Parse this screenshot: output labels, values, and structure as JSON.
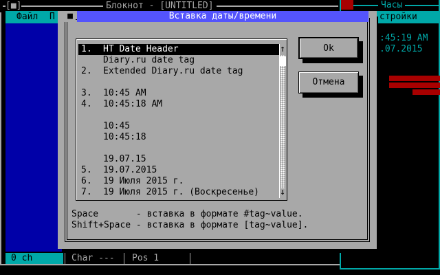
{
  "notepad": {
    "title": "Блокнот - [UNTITLED]",
    "close_glyph": "[■]",
    "menu": [
      "Файл",
      "П"
    ],
    "status": {
      "lines": "0 ch",
      "char": "Char ---",
      "pos": "Pos 1"
    }
  },
  "clock": {
    "title": "Часы",
    "menu_label": "стройки",
    "time": ":45:19 AM",
    "date": ".07.2015"
  },
  "dialog": {
    "title": "Вставка даты/времени",
    "sysmenu_glyph": "■",
    "items": [
      {
        "num": "1.",
        "text": "HT Date Header",
        "selected": true
      },
      {
        "num": "",
        "text": "Diary.ru date tag",
        "selected": false
      },
      {
        "num": "2.",
        "text": "Extended Diary.ru date tag",
        "selected": false
      },
      {
        "num": "",
        "text": "",
        "selected": false
      },
      {
        "num": "3.",
        "text": "10:45 AM",
        "selected": false
      },
      {
        "num": "4.",
        "text": "10:45:18 AM",
        "selected": false
      },
      {
        "num": "",
        "text": "",
        "selected": false
      },
      {
        "num": "",
        "text": "10:45",
        "selected": false
      },
      {
        "num": "",
        "text": "10:45:18",
        "selected": false
      },
      {
        "num": "",
        "text": "",
        "selected": false
      },
      {
        "num": "",
        "text": "19.07.15",
        "selected": false
      },
      {
        "num": "5.",
        "text": "19.07.2015",
        "selected": false
      },
      {
        "num": "6.",
        "text": "19 Июля 2015 г.",
        "selected": false
      },
      {
        "num": "7.",
        "text": "19 Июля 2015 г. (Воскресенье)",
        "selected": false
      }
    ],
    "scroll_up_glyph": "↑",
    "scroll_down_glyph": "↓",
    "ok_label": "Ok",
    "cancel_label": "Отмена",
    "hint_1": "Space       - вставка в формате #tag~value.",
    "hint_2": "Shift+Space - вставка в формате [tag~value]."
  },
  "colors": {
    "desktop": "#000000",
    "dialog_bg": "#a8a8a8",
    "dialog_title_bg": "#5454fc",
    "editor_bg": "#0000a8",
    "menubar_bg": "#00a8a8",
    "accent_red": "#a80000"
  },
  "icons": [
    "close-icon",
    "system-menu-icon",
    "scroll-up-arrow-icon",
    "scroll-down-arrow-icon"
  ]
}
